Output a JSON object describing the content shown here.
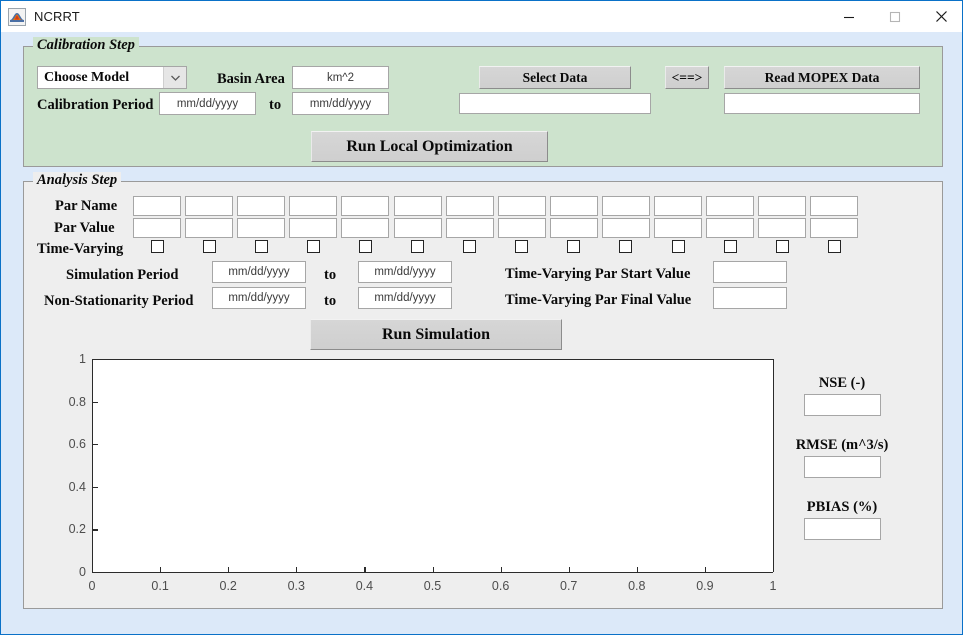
{
  "window": {
    "title": "NCRRT",
    "icon": "matlab-membrane-icon",
    "controls": {
      "minimize": "minimize-icon",
      "maximize": "maximize-icon",
      "close": "close-icon"
    }
  },
  "calibration": {
    "panel_title": "Calibration Step",
    "model_select": {
      "value": "Choose Model",
      "options": [
        "Choose Model"
      ]
    },
    "basin_area_label": "Basin Area",
    "basin_area_value": "",
    "basin_area_placeholder": "km^2",
    "calibration_period_label": "Calibration Period",
    "cal_start_value": "",
    "cal_start_placeholder": "mm/dd/yyyy",
    "to_label": "to",
    "cal_end_value": "",
    "cal_end_placeholder": "mm/dd/yyyy",
    "select_data_label": "Select Data",
    "swap_label": "<==>",
    "read_mopex_label": "Read MOPEX Data",
    "select_data_path": "",
    "mopex_path": "",
    "run_local_opt_label": "Run Local Optimization"
  },
  "analysis": {
    "panel_title": "Analysis Step",
    "par_name_label": "Par Name",
    "par_value_label": "Par Value",
    "time_varying_label": "Time-Varying",
    "par_count": 14,
    "par_names": [
      "",
      "",
      "",
      "",
      "",
      "",
      "",
      "",
      "",
      "",
      "",
      "",
      "",
      ""
    ],
    "par_values": [
      "",
      "",
      "",
      "",
      "",
      "",
      "",
      "",
      "",
      "",
      "",
      "",
      "",
      ""
    ],
    "time_varying_checked": [
      false,
      false,
      false,
      false,
      false,
      false,
      false,
      false,
      false,
      false,
      false,
      false,
      false,
      false
    ],
    "simulation_period_label": "Simulation Period",
    "sim_start_value": "",
    "sim_start_placeholder": "mm/dd/yyyy",
    "sim_to_label": "to",
    "sim_end_value": "",
    "sim_end_placeholder": "mm/dd/yyyy",
    "nonstationarity_period_label": "Non-Stationarity Period",
    "ns_start_value": "",
    "ns_start_placeholder": "mm/dd/yyyy",
    "ns_to_label": "to",
    "ns_end_value": "",
    "ns_end_placeholder": "mm/dd/yyyy",
    "tv_start_label": "Time-Varying Par Start Value",
    "tv_start_value": "",
    "tv_final_label": "Time-Varying Par Final Value",
    "tv_final_value": "",
    "run_simulation_label": "Run Simulation"
  },
  "metrics": [
    {
      "label": "NSE (-)",
      "value": ""
    },
    {
      "label": "RMSE (m^3/s)",
      "value": ""
    },
    {
      "label": "PBIAS (%)",
      "value": ""
    }
  ],
  "chart_data": {
    "type": "line",
    "title": "",
    "xlabel": "",
    "ylabel": "",
    "xlim": [
      0,
      1
    ],
    "ylim": [
      0,
      1
    ],
    "xticks": [
      0,
      0.1,
      0.2,
      0.3,
      0.4,
      0.5,
      0.6,
      0.7,
      0.8,
      0.9,
      1
    ],
    "xticklabels": [
      "0",
      "0.1",
      "0.2",
      "0.3",
      "0.4",
      "0.5",
      "0.6",
      "0.7",
      "0.8",
      "0.9",
      "1"
    ],
    "yticks": [
      0,
      0.2,
      0.4,
      0.6,
      0.8,
      1
    ],
    "yticklabels": [
      "0",
      "0.2",
      "0.4",
      "0.6",
      "0.8",
      "1"
    ],
    "grid": false,
    "legend": null,
    "series": []
  },
  "colors": {
    "window_bg": "#dce9f9",
    "window_border": "#0a71c8",
    "calibration_panel_bg": "#cde3cd",
    "analysis_panel_bg": "#eeeeee",
    "button_face": "#d4d0c8",
    "field_bg": "#ffffff",
    "text": "#0a0a0a"
  }
}
